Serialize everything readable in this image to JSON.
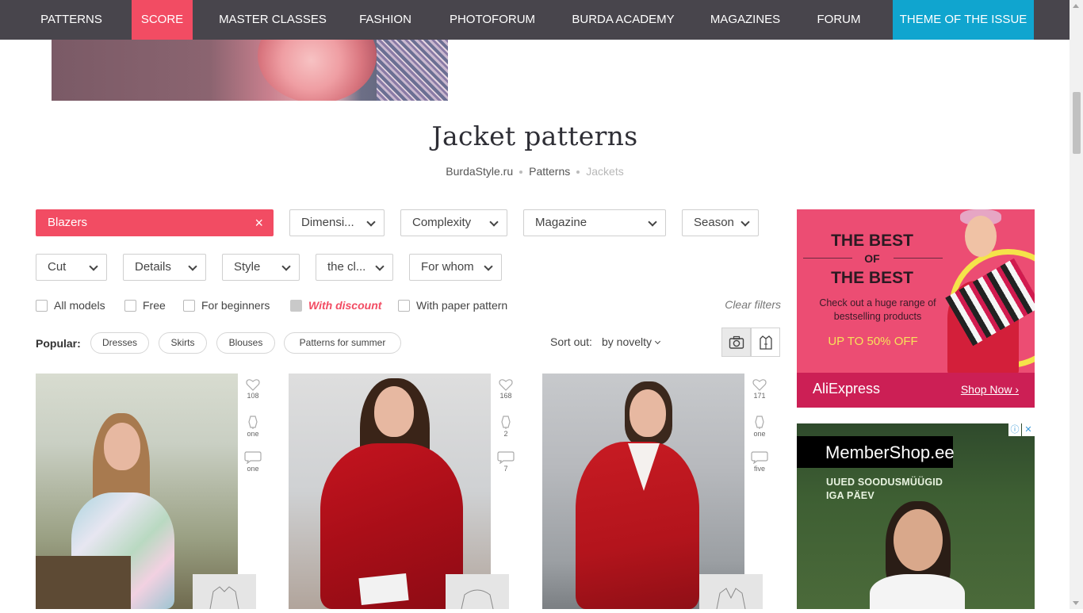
{
  "nav": {
    "items": [
      "PATTERNS",
      "SCORE",
      "MASTER CLASSES",
      "FASHION",
      "PHOTOFORUM",
      "BURDA ACADEMY",
      "MAGAZINES",
      "FORUM",
      "THEME OF THE ISSUE"
    ],
    "active_color": "#f24c63",
    "theme_color": "#10a5cf",
    "background": "#48454c"
  },
  "page": {
    "title": "Jacket patterns",
    "breadcrumb": [
      "BurdaStyle.ru",
      "Patterns",
      "Jackets"
    ]
  },
  "filters": {
    "row1": [
      "Blazers",
      "Dimensi...",
      "Complexity",
      "Magazine",
      "Season"
    ],
    "row2": [
      "Cut",
      "Details",
      "Style",
      "the cl...",
      "For whom"
    ],
    "active_filter": "Blazers",
    "checkboxes": [
      "All models",
      "Free",
      "For beginners",
      "With discount",
      "With paper pattern"
    ],
    "clear_label": "Clear filters"
  },
  "popular": {
    "label": "Popular:",
    "tags": [
      "Dresses",
      "Skirts",
      "Blouses",
      "Patterns for summer"
    ]
  },
  "sort": {
    "label": "Sort out:",
    "value": "by novelty"
  },
  "products": [
    {
      "likes": "108",
      "saves": "one",
      "comments": "one"
    },
    {
      "likes": "168",
      "saves": "2",
      "comments": "7"
    },
    {
      "likes": "171",
      "saves": "one",
      "comments": "five"
    }
  ],
  "ads": {
    "aliexpress": {
      "line1": "THE BEST",
      "line2": "OF",
      "line3": "THE BEST",
      "subtitle": "Check out a huge range of bestselling products",
      "promo": "UP TO 50% OFF",
      "brand": "AliExpress",
      "cta": "Shop Now ›"
    },
    "membershop": {
      "logo": "MemberShop.ee",
      "tagline_1": "UUED SOODUSMÜÜGID",
      "tagline_2": "IGA PÄEV",
      "icons": [
        "ⓘ",
        "✕"
      ]
    }
  }
}
